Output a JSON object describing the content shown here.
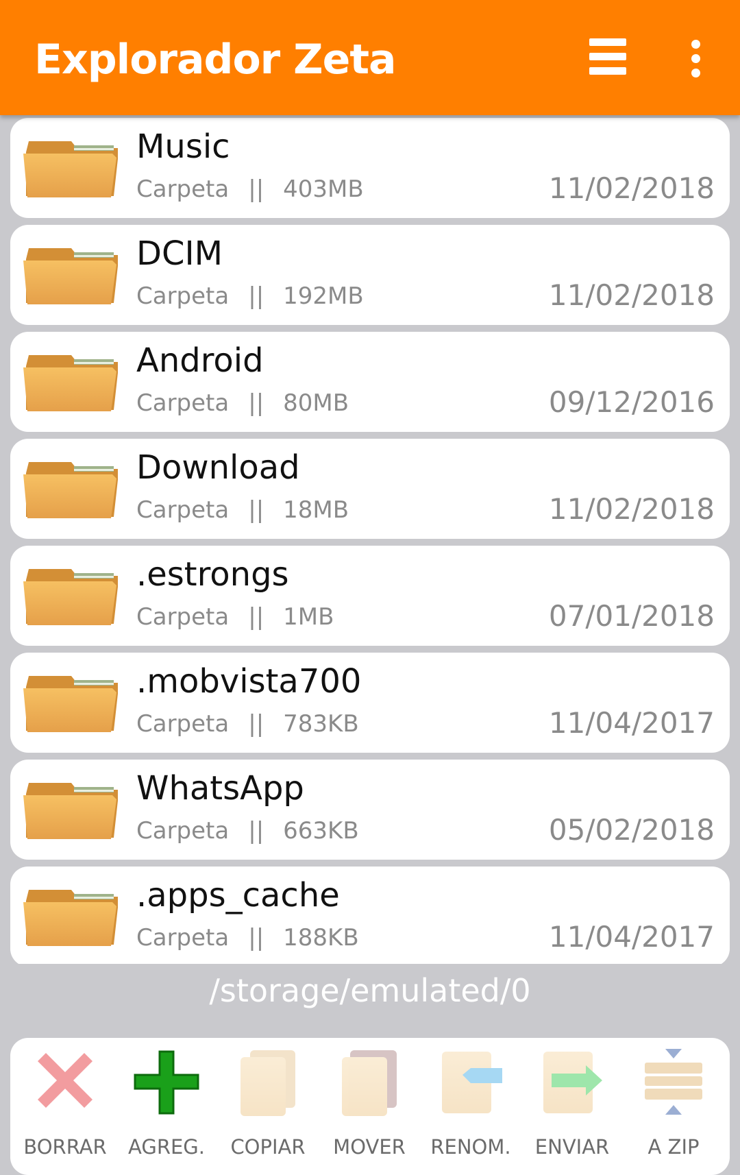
{
  "app": {
    "title": "Explorador Zeta",
    "accent_color": "#ff7f00"
  },
  "appbar": {
    "menu_icon": "hamburger-menu-icon",
    "more_icon": "more-vert-icon"
  },
  "files": [
    {
      "name": "Music",
      "type": "Carpeta",
      "separator": "||",
      "size": "403MB",
      "date": "11/02/2018"
    },
    {
      "name": "DCIM",
      "type": "Carpeta",
      "separator": "||",
      "size": "192MB",
      "date": "11/02/2018"
    },
    {
      "name": "Android",
      "type": "Carpeta",
      "separator": "||",
      "size": "80MB",
      "date": "09/12/2016"
    },
    {
      "name": "Download",
      "type": "Carpeta",
      "separator": "||",
      "size": "18MB",
      "date": "11/02/2018"
    },
    {
      "name": ".estrongs",
      "type": "Carpeta",
      "separator": "||",
      "size": "1MB",
      "date": "07/01/2018"
    },
    {
      "name": ".mobvista700",
      "type": "Carpeta",
      "separator": "||",
      "size": "783KB",
      "date": "11/04/2017"
    },
    {
      "name": "WhatsApp",
      "type": "Carpeta",
      "separator": "||",
      "size": "663KB",
      "date": "05/02/2018"
    },
    {
      "name": ".apps_cache",
      "type": "Carpeta",
      "separator": "||",
      "size": "188KB",
      "date": "11/04/2017"
    }
  ],
  "path": "/storage/emulated/0",
  "toolbar": [
    {
      "label": "BORRAR",
      "icon": "delete-x-icon"
    },
    {
      "label": "AGREG.",
      "icon": "add-plus-icon"
    },
    {
      "label": "COPIAR",
      "icon": "copy-icon"
    },
    {
      "label": "MOVER",
      "icon": "move-icon"
    },
    {
      "label": "RENOM.",
      "icon": "rename-icon"
    },
    {
      "label": "ENVIAR",
      "icon": "send-icon"
    },
    {
      "label": "A ZIP",
      "icon": "zip-icon"
    }
  ]
}
